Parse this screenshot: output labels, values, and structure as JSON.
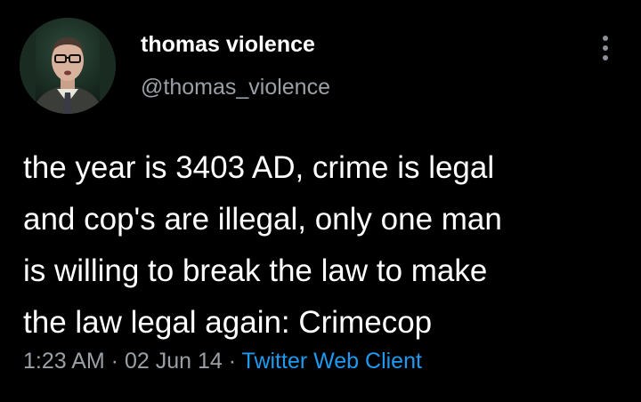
{
  "author": {
    "display_name": "thomas violence",
    "handle": "@thomas_violence",
    "avatar_icon": "profile-photo-man-with-glasses"
  },
  "tweet": {
    "text_lines": [
      "the year is 3403 AD, crime is legal",
      "and cop's are illegal, only one man",
      "is willing to break the law to make",
      "the law legal again: Crimecop"
    ]
  },
  "meta": {
    "time": "1:23 AM",
    "sep1": " · ",
    "date": "02 Jun 14",
    "sep2": " · ",
    "source": "Twitter Web Client"
  },
  "menu": {
    "icon": "vertical-ellipsis-icon"
  },
  "colors": {
    "background": "#000000",
    "text": "#ffffff",
    "secondary": "#9aa0a6",
    "link": "#1d9bf0"
  }
}
